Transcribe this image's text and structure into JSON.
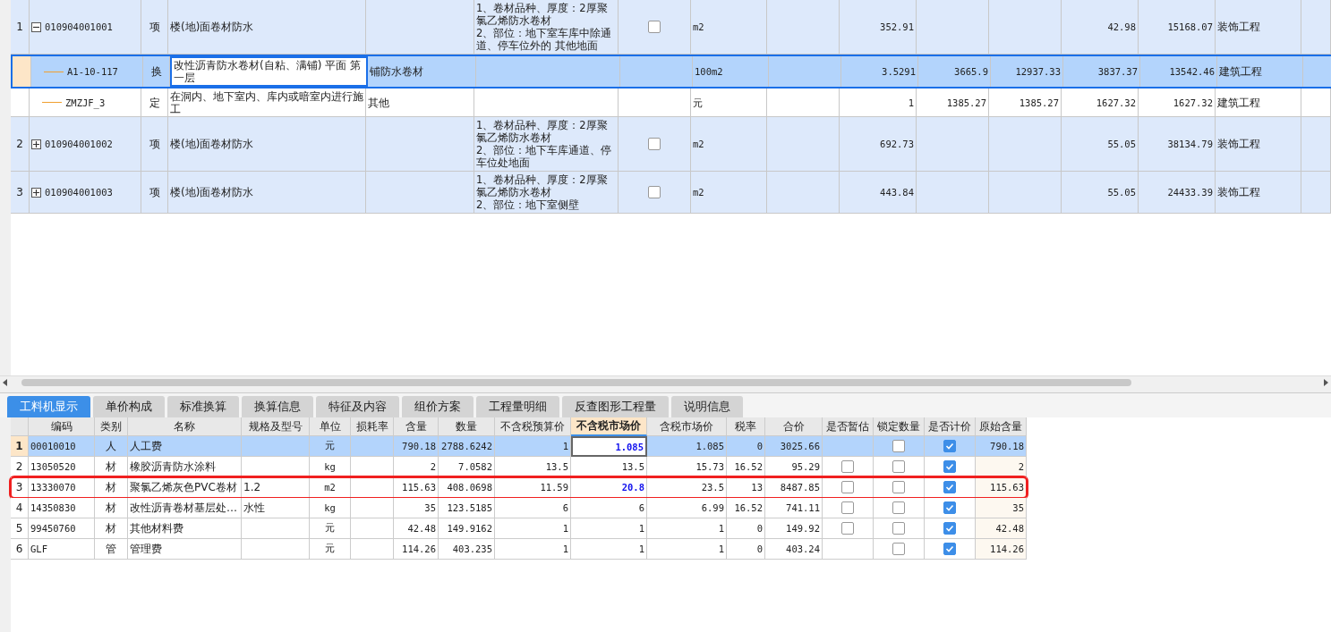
{
  "bill_rows": [
    {
      "number": "1",
      "code": "010904001001",
      "type": "项",
      "name": "楼(地)面卷材防水",
      "features": [
        "1、卷材品种、厚度：2厚聚氯乙烯防水卷材",
        "2、部位：地下室车库中除通道、停车位外的 其他地面"
      ],
      "checked": false,
      "unit": "m2",
      "column_10": "352.91",
      "column_14": "42.98",
      "column_15": "15168.07",
      "category": "装饰工程",
      "expanded": true,
      "selected": false,
      "children": [
        {
          "code": "A1-10-117",
          "type": "换",
          "name": "改性沥青防水卷材(自粘、满铺) 平面 第一层",
          "column_5": "铺防水卷材",
          "unit": "100m2",
          "column_10": "3.5291",
          "column_11": "3665.9",
          "column_12": "12937.33",
          "column_14": "3837.37",
          "column_15": "13542.46",
          "category": "建筑工程",
          "selected": true
        },
        {
          "code": "ZMZJF_3",
          "type": "定",
          "name": "在洞内、地下室内、库内或暗室内进行施工",
          "column_5": "其他",
          "unit": "元",
          "column_10": "1",
          "column_11": "1385.27",
          "column_12": "1385.27",
          "column_14": "1627.32",
          "column_15": "1627.32",
          "category": "建筑工程",
          "selected": false
        }
      ]
    },
    {
      "number": "2",
      "code": "010904001002",
      "type": "项",
      "name": "楼(地)面卷材防水",
      "features": [
        "1、卷材品种、厚度：2厚聚氯乙烯防水卷材",
        "2、部位：地下车库通道、停车位处地面"
      ],
      "checked": false,
      "unit": "m2",
      "column_10": "692.73",
      "column_14": "55.05",
      "column_15": "38134.79",
      "category": "装饰工程",
      "expanded": false,
      "selected": false
    },
    {
      "number": "3",
      "code": "010904001003",
      "type": "项",
      "name": "楼(地)面卷材防水",
      "features": [
        "1、卷材品种、厚度：2厚聚氯乙烯防水卷材",
        "2、部位：地下室侧壁"
      ],
      "checked": false,
      "unit": "m2",
      "column_10": "443.84",
      "column_14": "55.05",
      "column_15": "24433.39",
      "category": "装饰工程",
      "expanded": false,
      "selected": false
    }
  ],
  "tabs": [
    {
      "label": "工料机显示",
      "selected": true
    },
    {
      "label": "单价构成",
      "selected": false
    },
    {
      "label": "标准换算",
      "selected": false
    },
    {
      "label": "换算信息",
      "selected": false
    },
    {
      "label": "特征及内容",
      "selected": false
    },
    {
      "label": "组价方案",
      "selected": false
    },
    {
      "label": "工程量明细",
      "selected": false
    },
    {
      "label": "反查图形工程量",
      "selected": false
    },
    {
      "label": "说明信息",
      "selected": false
    }
  ],
  "materials": {
    "columns": [
      {
        "label": "编码",
        "active": false
      },
      {
        "label": "类别",
        "active": false
      },
      {
        "label": "名称",
        "active": false
      },
      {
        "label": "规格及型号",
        "active": false
      },
      {
        "label": "单位",
        "active": false
      },
      {
        "label": "损耗率",
        "active": false
      },
      {
        "label": "含量",
        "active": false
      },
      {
        "label": "数量",
        "active": false
      },
      {
        "label": "不含税预算价",
        "active": false
      },
      {
        "label": "不含税市场价",
        "active": true
      },
      {
        "label": "含税市场价",
        "active": false
      },
      {
        "label": "税率",
        "active": false
      },
      {
        "label": "合价",
        "active": false
      },
      {
        "label": "是否暂估",
        "active": false
      },
      {
        "label": "锁定数量",
        "active": false
      },
      {
        "label": "是否计价",
        "active": false
      },
      {
        "label": "原始含量",
        "active": false
      }
    ],
    "rows": [
      {
        "number": "1",
        "code": "00010010",
        "type": "人",
        "name": "人工费",
        "unit": "元",
        "content": "790.18",
        "quantity": "2788.6242",
        "budget_price": "1",
        "market_price": "1.085",
        "modified": true,
        "tax_price": "1.085",
        "tax_rate": "0",
        "total": "3025.66",
        "locked": false,
        "priced": true,
        "original_content": "790.18",
        "selected": true,
        "highlighted": false
      },
      {
        "number": "2",
        "code": "13050520",
        "type": "材",
        "name": "橡胶沥青防水涂料",
        "unit": "kg",
        "content": "2",
        "quantity": "7.0582",
        "budget_price": "13.5",
        "market_price": "13.5",
        "modified": false,
        "tax_price": "15.73",
        "tax_rate": "16.52",
        "total": "95.29",
        "estimate": false,
        "locked": false,
        "priced": true,
        "original_content": "2",
        "selected": false,
        "highlighted": false
      },
      {
        "number": "3",
        "code": "13330070",
        "type": "材",
        "name": "聚氯乙烯灰色PVC卷材",
        "spec": "1.2",
        "unit": "m2",
        "content": "115.63",
        "quantity": "408.0698",
        "budget_price": "11.59",
        "market_price": "20.8",
        "modified": true,
        "tax_price": "23.5",
        "tax_rate": "13",
        "total": "8487.85",
        "estimate": false,
        "locked": false,
        "priced": true,
        "original_content": "115.63",
        "selected": false,
        "highlighted": true
      },
      {
        "number": "4",
        "code": "14350830",
        "type": "材",
        "name": "改性沥青卷材基层处…",
        "spec": "水性",
        "unit": "kg",
        "content": "35",
        "quantity": "123.5185",
        "budget_price": "6",
        "market_price": "6",
        "modified": false,
        "tax_price": "6.99",
        "tax_rate": "16.52",
        "total": "741.11",
        "estimate": false,
        "locked": false,
        "priced": true,
        "original_content": "35",
        "selected": false,
        "highlighted": false
      },
      {
        "number": "5",
        "code": "99450760",
        "type": "材",
        "name": "其他材料费",
        "unit": "元",
        "content": "42.48",
        "quantity": "149.9162",
        "budget_price": "1",
        "market_price": "1",
        "modified": false,
        "tax_price": "1",
        "tax_rate": "0",
        "total": "149.92",
        "estimate": false,
        "locked": false,
        "priced": true,
        "original_content": "42.48",
        "selected": false,
        "highlighted": false
      },
      {
        "number": "6",
        "code": "GLF",
        "type": "管",
        "name": "管理费",
        "unit": "元",
        "content": "114.26",
        "quantity": "403.235",
        "budget_price": "1",
        "market_price": "1",
        "modified": false,
        "tax_price": "1",
        "tax_rate": "0",
        "total": "403.24",
        "locked": false,
        "priced": true,
        "original_content": "114.26",
        "selected": false,
        "highlighted": false
      }
    ]
  }
}
